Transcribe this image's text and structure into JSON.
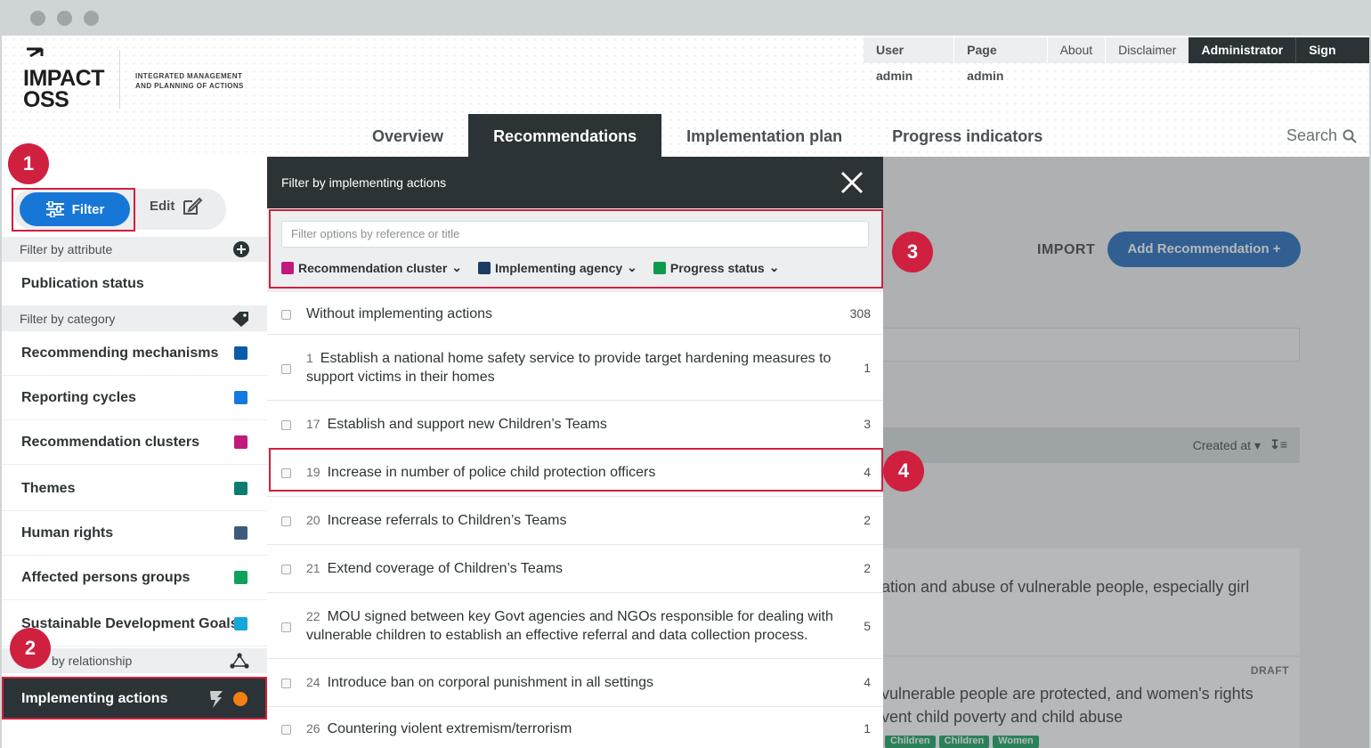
{
  "header": {
    "logo_text_line1": "IMPACT",
    "logo_text_line2": "OSS",
    "tagline_line1": "INTEGRATED MANAGEMENT",
    "tagline_line2": "AND PLANNING OF ACTIONS",
    "top_nav": [
      "User admin",
      "Page admin",
      "About",
      "Disclaimer",
      "Administrator",
      "Sign out"
    ],
    "main_nav": [
      "Overview",
      "Recommendations",
      "Implementation plan",
      "Progress indicators"
    ],
    "active_main_nav": "Recommendations",
    "search_label": "Search"
  },
  "sidebar": {
    "filter_label": "Filter",
    "edit_label": "Edit",
    "attribute_header": "Filter by attribute",
    "attribute_items": [
      "Publication status"
    ],
    "category_header": "Filter by category",
    "category_items": [
      {
        "label": "Recommending mechanisms",
        "color": "#0b5ba8"
      },
      {
        "label": "Reporting cycles",
        "color": "#1679e0"
      },
      {
        "label": "Recommendation clusters",
        "color": "#c01a7c"
      },
      {
        "label": "Themes",
        "color": "#0a7d6e"
      },
      {
        "label": "Human rights",
        "color": "#3d5c7d"
      },
      {
        "label": "Affected persons groups",
        "color": "#0fa15a"
      },
      {
        "label": "Sustainable Development Goals",
        "color": "#17a6d9"
      }
    ],
    "relationship_header": "by relationship",
    "active_item": "Implementing actions",
    "active_item_dot_color": "#f07f14"
  },
  "panel": {
    "title": "Filter by implementing actions",
    "search_placeholder": "Filter options by reference or title",
    "chips": [
      {
        "label": "Recommendation cluster",
        "color": "#c01a7c"
      },
      {
        "label": "Implementing agency",
        "color": "#1c3d63"
      },
      {
        "label": "Progress status",
        "color": "#0e9a4d"
      }
    ],
    "options": [
      {
        "ref": "",
        "title": "Without implementing actions",
        "count": "308"
      },
      {
        "ref": "1",
        "title": "Establish a national home safety service to provide target hardening measures to support victims in their homes",
        "count": "1"
      },
      {
        "ref": "17",
        "title": "Establish and support new Children’s Teams",
        "count": "3"
      },
      {
        "ref": "19",
        "title": "Increase in number of police child protection officers",
        "count": "4"
      },
      {
        "ref": "20",
        "title": "Increase referrals to Children’s Teams",
        "count": "2"
      },
      {
        "ref": "21",
        "title": "Extend coverage of Children’s Teams",
        "count": "2"
      },
      {
        "ref": "22",
        "title": "MOU signed between key Govt agencies and NGOs responsible for dealing with vulnerable children to establish an effective referral and data collection process.",
        "count": "5"
      },
      {
        "ref": "24",
        "title": "Introduce ban on corporal punishment in all settings",
        "count": "4"
      },
      {
        "ref": "26",
        "title": "Countering violent extremism/terrorism",
        "count": "1"
      }
    ]
  },
  "background": {
    "import_label": "IMPORT",
    "add_button_label": "Add Recommendation +",
    "sort_label": "Created at",
    "card1_text": "ation and abuse of vulnerable people, especially girl",
    "card2_status": "DRAFT",
    "card2_text_line1": "vulnerable people are protected, and women's rights",
    "card2_text_line2": "vent child poverty and child abuse",
    "card2_tags": [
      "Children",
      "Children",
      "Women"
    ]
  },
  "annotations": [
    "1",
    "2",
    "3",
    "4"
  ]
}
